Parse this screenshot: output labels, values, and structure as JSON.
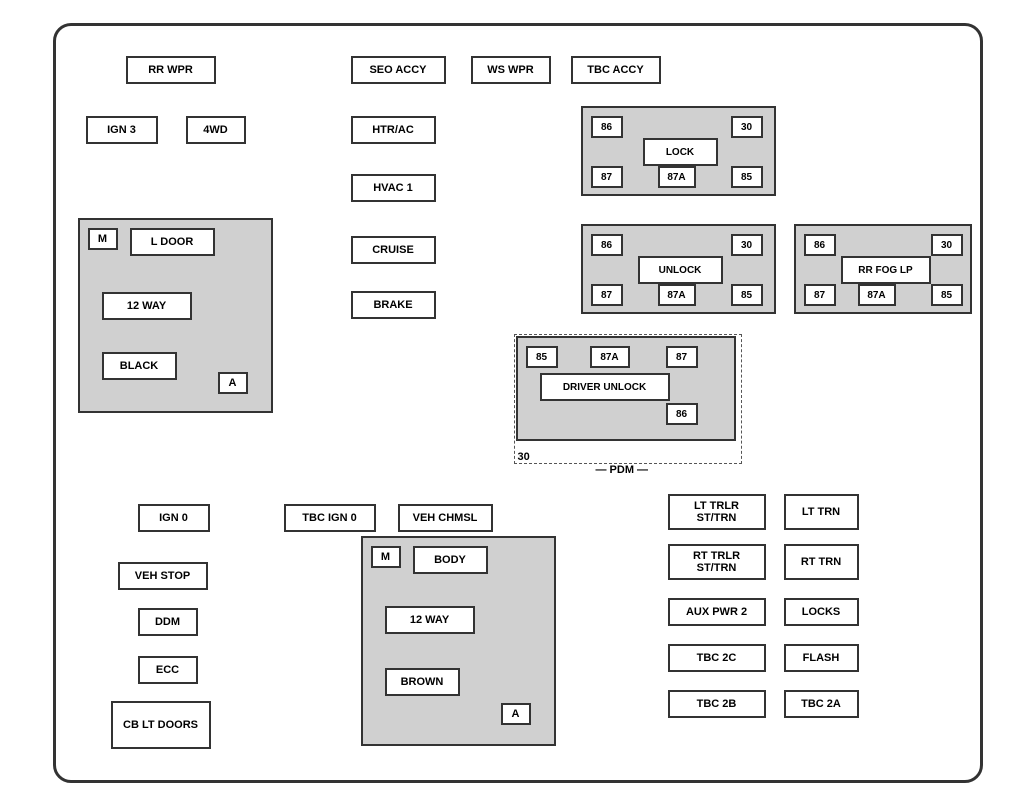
{
  "labels": {
    "rr_wpr": "RR WPR",
    "seo_accy": "SEO ACCY",
    "ws_wpr": "WS WPR",
    "tbc_accy": "TBC ACCY",
    "ign3": "IGN 3",
    "fwd": "4WD",
    "htr_ac": "HTR/AC",
    "hvac1": "HVAC 1",
    "cruise": "CRUISE",
    "brake": "BRAKE",
    "m_ldoor": "M",
    "l_door": "L DOOR",
    "twelve_way_1": "12 WAY",
    "black": "BLACK",
    "a1": "A",
    "lock": "LOCK",
    "unlock": "UNLOCK",
    "rr_fog_lp": "RR FOG LP",
    "driver_unlock": "DRIVER UNLOCK",
    "num_86a": "86",
    "num_30a": "30",
    "num_87a": "87",
    "num_87Aa": "87A",
    "num_85a": "85",
    "num_86b": "86",
    "num_30b": "30",
    "num_87b": "87",
    "num_87Ab": "87A",
    "num_85b": "85",
    "num_86c": "86",
    "num_30c": "30",
    "num_87c": "87",
    "num_87Ac": "87A",
    "num_85c": "85",
    "num_85d": "85",
    "num_87Ad": "87A",
    "num_87d": "87",
    "num_30d": "30",
    "num_86d": "86",
    "ign0": "IGN 0",
    "tbc_ign0": "TBC IGN 0",
    "veh_chmsl": "VEH CHMSL",
    "veh_stop": "VEH STOP",
    "ddm": "DDM",
    "ecc": "ECC",
    "cb_lt_doors": "CB\nLT DOORS",
    "m_body": "M",
    "body": "BODY",
    "twelve_way_2": "12 WAY",
    "brown": "BROWN",
    "a2": "A",
    "lt_trlr_st_trn": "LT TRLR\nST/TRN",
    "lt_trn": "LT TRN",
    "rt_trlr_st_trn": "RT TRLR\nST/TRN",
    "rt_trn": "RT TRN",
    "aux_pwr2": "AUX PWR 2",
    "locks": "LOCKS",
    "tbc_2c": "TBC 2C",
    "flash": "FLASH",
    "tbc_2b": "TBC 2B",
    "tbc_2a": "TBC 2A",
    "pdm": "PDM"
  }
}
